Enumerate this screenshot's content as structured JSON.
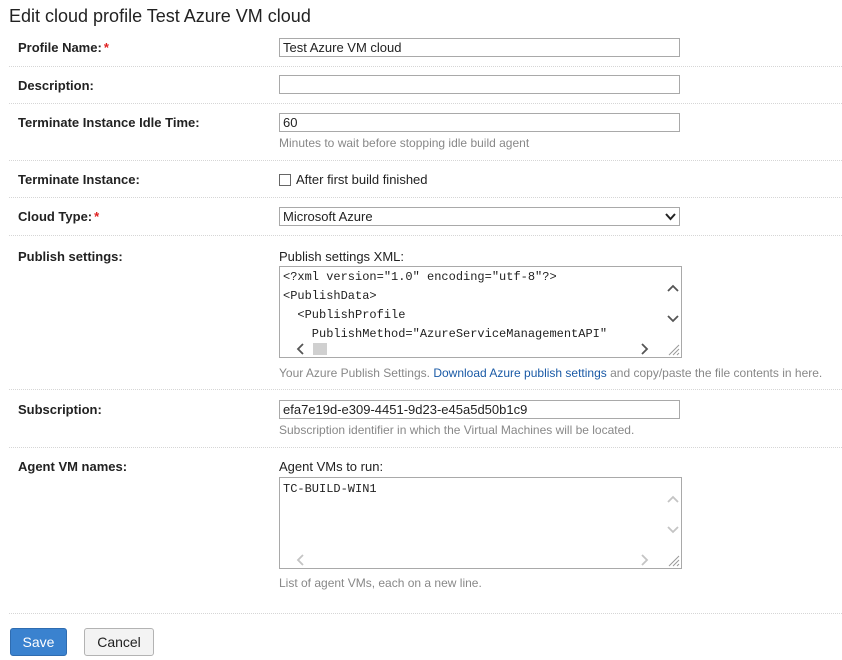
{
  "page": {
    "title": "Edit cloud profile Test Azure VM cloud"
  },
  "form": {
    "profile_name": {
      "label": "Profile Name:",
      "required_mark": "*",
      "value": "Test Azure VM cloud"
    },
    "description": {
      "label": "Description:",
      "value": ""
    },
    "terminate_idle": {
      "label": "Terminate Instance Idle Time:",
      "value": "60",
      "hint": "Minutes to wait before stopping idle build agent"
    },
    "terminate_instance": {
      "label": "Terminate Instance:",
      "checkbox_label": "After first build finished",
      "checked": false
    },
    "cloud_type": {
      "label": "Cloud Type:",
      "required_mark": "*",
      "selected": "Microsoft Azure"
    },
    "publish_settings": {
      "label": "Publish settings:",
      "sublabel": "Publish settings XML:",
      "lines": [
        "<?xml version=\"1.0\" encoding=\"utf-8\"?>",
        "<PublishData>",
        "  <PublishProfile",
        "    PublishMethod=\"AzureServiceManagementAPI\""
      ],
      "hint_prefix": "Your Azure Publish Settings.",
      "hint_link": "Download Azure publish settings",
      "hint_suffix": "and copy/paste the file contents in here."
    },
    "subscription": {
      "label": "Subscription:",
      "value": "efa7e19d-e309-4451-9d23-e45a5d50b1c9",
      "hint": "Subscription identifier in which the Virtual Machines will be located."
    },
    "agent_vms": {
      "label": "Agent VM names:",
      "sublabel": "Agent VMs to run:",
      "lines": [
        "TC-BUILD-WIN1"
      ],
      "hint": "List of agent VMs, each on a new line."
    }
  },
  "buttons": {
    "save": "Save",
    "cancel": "Cancel"
  }
}
